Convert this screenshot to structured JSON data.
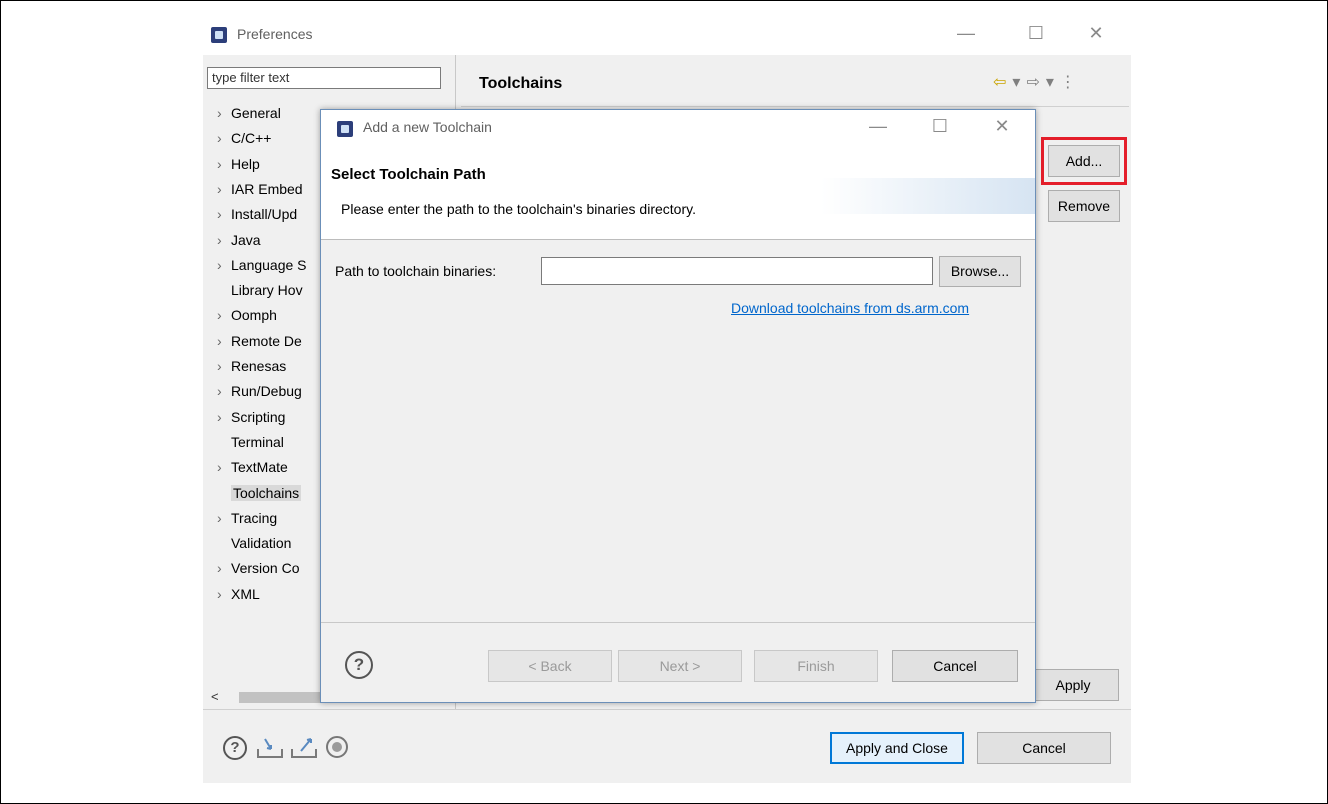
{
  "preferences": {
    "title": "Preferences",
    "filter_placeholder": "type filter text",
    "tree": [
      {
        "label": "General",
        "expandable": true
      },
      {
        "label": "C/C++",
        "expandable": true
      },
      {
        "label": "Help",
        "expandable": true
      },
      {
        "label": "IAR Embed",
        "expandable": true
      },
      {
        "label": "Install/Upd",
        "expandable": true
      },
      {
        "label": "Java",
        "expandable": true
      },
      {
        "label": "Language S",
        "expandable": true
      },
      {
        "label": "Library Hov",
        "expandable": false
      },
      {
        "label": "Oomph",
        "expandable": true
      },
      {
        "label": "Remote De",
        "expandable": true
      },
      {
        "label": "Renesas",
        "expandable": true
      },
      {
        "label": "Run/Debug",
        "expandable": true
      },
      {
        "label": "Scripting",
        "expandable": true
      },
      {
        "label": "Terminal",
        "expandable": false
      },
      {
        "label": "TextMate",
        "expandable": true
      },
      {
        "label": "Toolchains",
        "expandable": false,
        "selected": true
      },
      {
        "label": "Tracing",
        "expandable": true
      },
      {
        "label": "Validation",
        "expandable": false
      },
      {
        "label": "Version Co",
        "expandable": true
      },
      {
        "label": "XML",
        "expandable": true
      }
    ],
    "page_title": "Toolchains",
    "add_button": "Add...",
    "remove_button": "Remove",
    "apply_button": "Apply",
    "apply_close_button": "Apply and Close",
    "cancel_button": "Cancel"
  },
  "dialog": {
    "title": "Add a new Toolchain",
    "heading": "Select Toolchain Path",
    "message": "Please enter the path to the toolchain's binaries directory.",
    "path_label": "Path to toolchain binaries:",
    "path_value": "",
    "browse_button": "Browse...",
    "download_link": "Download toolchains from ds.arm.com",
    "back_button": "< Back",
    "next_button": "Next >",
    "finish_button": "Finish",
    "cancel_button": "Cancel"
  },
  "icons": {
    "help": "?",
    "arrow_left": "⇦",
    "arrow_right": "⇨",
    "dropdown": "▾",
    "menu": "⋮",
    "minimize": "—",
    "maximize": "☐",
    "close": "✕",
    "tree_arrow": "›",
    "scroll_left": "<"
  },
  "colors": {
    "highlight": "#e41e2a",
    "link": "#0066cc",
    "focus": "#0078d7"
  }
}
